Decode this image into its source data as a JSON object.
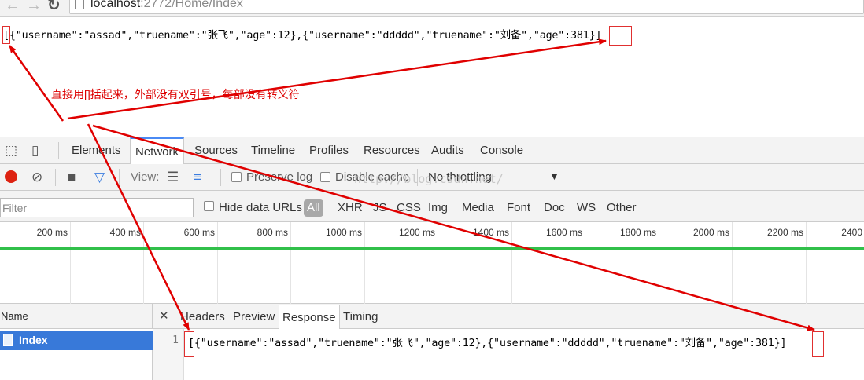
{
  "browser": {
    "url_host": "localhost",
    "url_rest": ":2772/Home/Index"
  },
  "page": {
    "json_text": "[{\"username\":\"assad\",\"truename\":\"张飞\",\"age\":12},{\"username\":\"ddddd\",\"truename\":\"刘备\",\"age\":381}]",
    "annotation": "直接用[]括起来，外部没有双引号，每部没有转义符"
  },
  "devtools": {
    "tabs": [
      "Elements",
      "Network",
      "Sources",
      "Timeline",
      "Profiles",
      "Resources",
      "Audits",
      "Console"
    ],
    "active_tab": "Network",
    "toolbar": {
      "view_label": "View:",
      "preserve_log": "Preserve log",
      "disable_cache": "Disable cache",
      "throttling": "No throttling"
    },
    "filter": {
      "placeholder": "Filter",
      "hide_data_urls": "Hide data URLs",
      "all": "All",
      "types": [
        "XHR",
        "JS",
        "CSS",
        "Img",
        "Media",
        "Font",
        "Doc",
        "WS",
        "Other"
      ]
    },
    "timeline_ticks": [
      "200 ms",
      "400 ms",
      "600 ms",
      "800 ms",
      "1000 ms",
      "1200 ms",
      "1400 ms",
      "1600 ms",
      "1800 ms",
      "2000 ms",
      "2200 ms",
      "2400"
    ],
    "requests": {
      "header": "Name",
      "rows": [
        "Index"
      ]
    },
    "detail": {
      "tabs": [
        "Headers",
        "Preview",
        "Response",
        "Timing"
      ],
      "active_tab": "Response",
      "line_number": "1",
      "response_text": "[{\"username\":\"assad\",\"truename\":\"张飞\",\"age\":12},{\"username\":\"ddddd\",\"truename\":\"刘备\",\"age\":381}]"
    },
    "watermark": "http://blog.csdn.net/"
  },
  "colors": {
    "annotation_red": "#e00000",
    "devtools_selection": "#3879d9",
    "timeline_green": "#31c04a"
  }
}
